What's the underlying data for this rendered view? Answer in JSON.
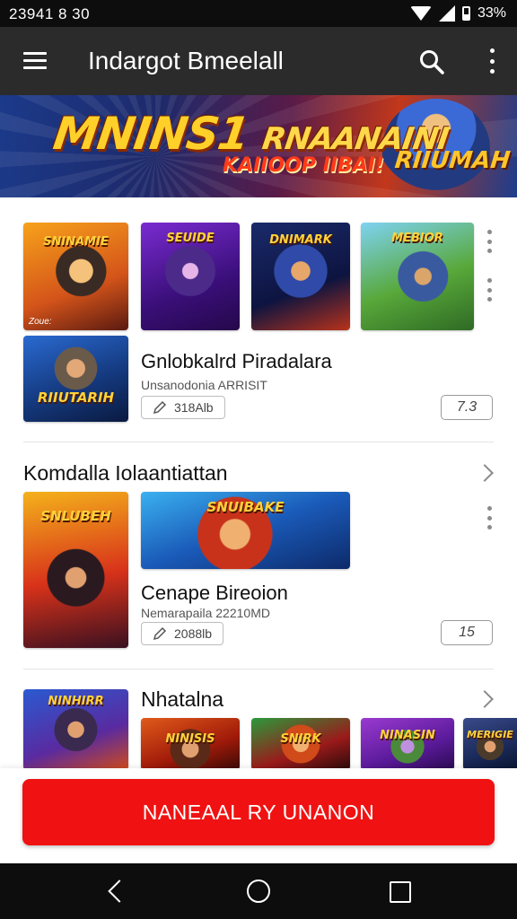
{
  "status_bar": {
    "time": "23941 8 30",
    "battery": "33%"
  },
  "app_bar": {
    "title": "Indargot Bmeelall"
  },
  "banner": {
    "title": "MNINS1",
    "title2": "RNAANAINI",
    "subtitle": "KAIIOOP IIBAI!",
    "badge": "RIIUMAH"
  },
  "featured": {
    "thumbs": [
      {
        "caption": "SNINAMIE",
        "sub": "Zoue:"
      },
      {
        "caption": "SEUIDE"
      },
      {
        "caption": "DNIMARK"
      },
      {
        "caption": "MEBIOR"
      },
      {
        "caption": "RIIUTARIH"
      }
    ],
    "title": "Gnlobkalrd Piradalara",
    "subtitle": "Unsanodonia  ARRISIT",
    "size": "318Alb",
    "rating": "7.3"
  },
  "section1": {
    "title": "Komdalla Iolaantiattan",
    "thumbs": [
      {
        "caption": "SNLUBEH"
      },
      {
        "caption": "SNUIBAKE"
      }
    ],
    "item_title": "Cenape Bireoion",
    "item_subtitle": "Nemarapaila  22210MD",
    "size": "2088lb",
    "rating": "15"
  },
  "section2": {
    "title": "Nhatalna",
    "thumbs": [
      {
        "caption": "NINHIRR"
      },
      {
        "caption": "NINISIS"
      },
      {
        "caption": "SNIRK"
      },
      {
        "caption": "NINASIN"
      },
      {
        "caption": "MERIGIE"
      }
    ]
  },
  "cta": {
    "label": "NANEAAL RY UNANON"
  },
  "colors": {
    "primary_button": "#f01212",
    "app_bar": "#2b2b2b",
    "system_bars": "#0d0d0d"
  }
}
